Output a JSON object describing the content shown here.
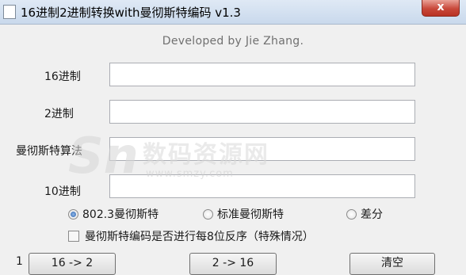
{
  "window": {
    "title": "16进制2进制转换with曼彻斯特编码 v1.3",
    "close_symbol": "x"
  },
  "credit": "Developed by Jie Zhang.",
  "fields": {
    "hex": {
      "label": "16进制",
      "value": ""
    },
    "binary": {
      "label": "2进制",
      "value": ""
    },
    "manchester": {
      "label": "曼彻斯特算法",
      "value": ""
    },
    "decimal": {
      "label": "10进制",
      "value": ""
    }
  },
  "radios": {
    "r8023": {
      "label": "802.3曼彻斯特",
      "checked": true
    },
    "standard": {
      "label": "标准曼彻斯特",
      "checked": false
    },
    "diff": {
      "label": "差分",
      "checked": false
    }
  },
  "checkbox": {
    "label": "曼彻斯特编码是否进行每8位反序（特殊情况）",
    "checked": false
  },
  "status_number": "1",
  "buttons": {
    "hex_to_bin": "16 -> 2",
    "bin_to_hex": "2 -> 16",
    "clear": "清空"
  },
  "watermark": {
    "title": "数码资源网",
    "url": "www.smzy.com"
  },
  "colors": {
    "titlebar": "#c9d9ec",
    "close": "#c8483a",
    "radio_checked": "#2a62b0"
  }
}
